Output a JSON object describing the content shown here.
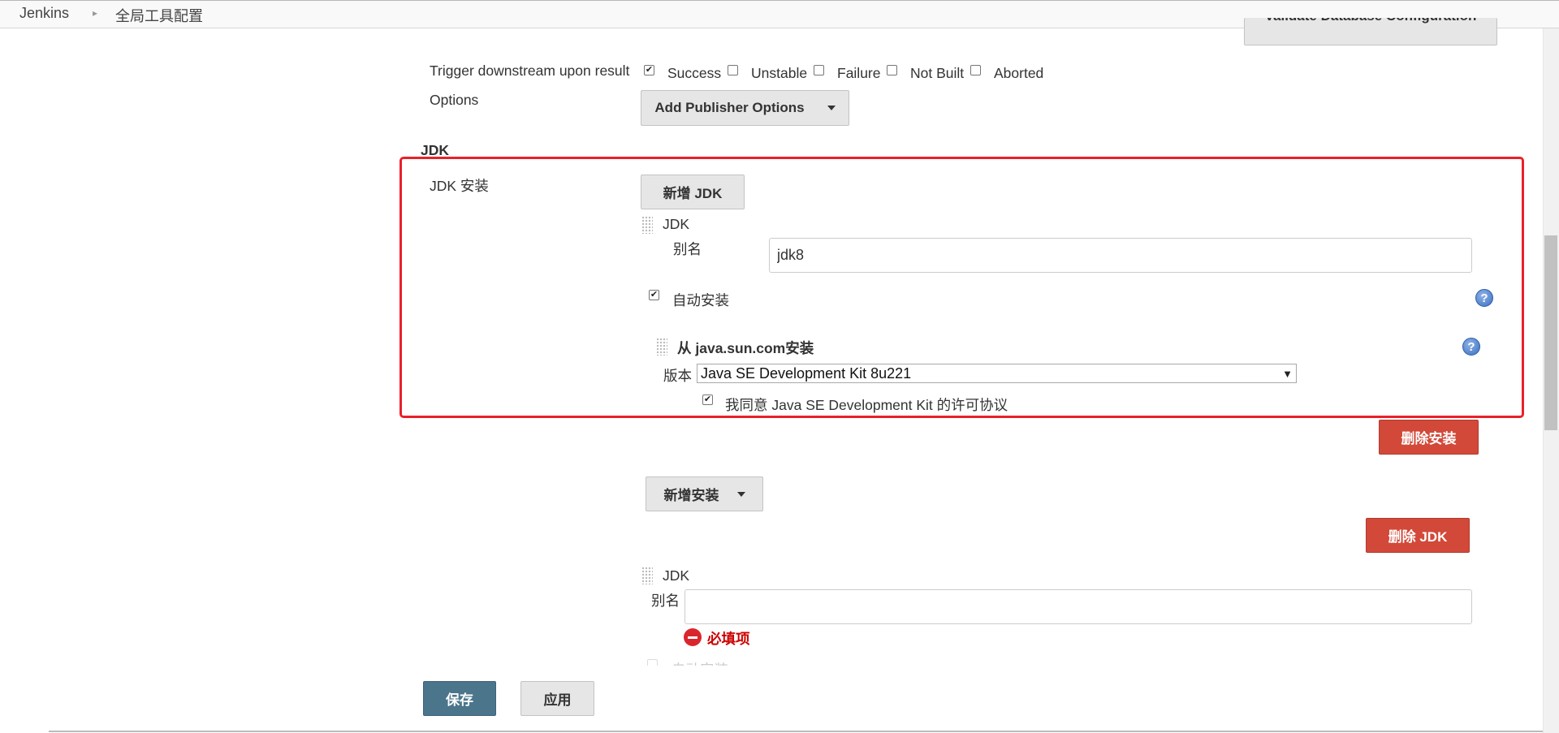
{
  "breadcrumb": {
    "root": "Jenkins",
    "current": "全局工具配置"
  },
  "header_partial_button": "Validate Database Configuration",
  "trigger": {
    "label": "Trigger downstream upon result",
    "options": [
      {
        "label": "Success",
        "checked": true
      },
      {
        "label": "Unstable",
        "checked": false
      },
      {
        "label": "Failure",
        "checked": false
      },
      {
        "label": "Not Built",
        "checked": false
      },
      {
        "label": "Aborted",
        "checked": false
      }
    ]
  },
  "options_label": "Options",
  "add_publisher_options": "Add Publisher Options",
  "jdk_section_title": "JDK",
  "jdk_install_label": "JDK 安装",
  "add_jdk_button": "新增 JDK",
  "jdk1": {
    "title": "JDK",
    "alias_label": "别名",
    "alias_value": "jdk8",
    "auto_install_label": "自动安装",
    "auto_install_checked": true,
    "installer_title": "从 java.sun.com安装",
    "version_label": "版本",
    "version_value": "Java SE Development Kit 8u221",
    "agree_label": "我同意 Java SE Development Kit 的许可协议",
    "agree_checked": true,
    "delete_installer_button": "删除安装",
    "add_installer_button": "新增安装",
    "delete_jdk_button": "删除 JDK"
  },
  "jdk2": {
    "title": "JDK",
    "alias_label": "别名",
    "alias_value": "",
    "required_msg": "必填项",
    "auto_install_label": "自动安装"
  },
  "save_button": "保存",
  "apply_button": "应用",
  "colors": {
    "red_button": "#d24939",
    "blue_button": "#4b758b",
    "highlight_box": "#e8212a",
    "error_text": "#cc0000"
  }
}
